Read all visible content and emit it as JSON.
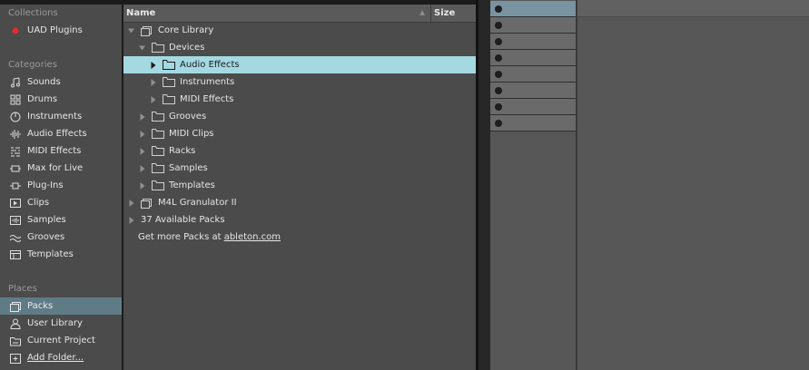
{
  "sidebar": {
    "collections_title": "Collections",
    "collections": [
      {
        "label": "UAD Plugins",
        "icon": "red-dot-icon",
        "color": "#e52b2b"
      }
    ],
    "categories_title": "Categories",
    "categories": [
      {
        "label": "Sounds",
        "icon": "sounds-icon"
      },
      {
        "label": "Drums",
        "icon": "drums-icon"
      },
      {
        "label": "Instruments",
        "icon": "instruments-icon"
      },
      {
        "label": "Audio Effects",
        "icon": "audio-effects-icon"
      },
      {
        "label": "MIDI Effects",
        "icon": "midi-effects-icon"
      },
      {
        "label": "Max for Live",
        "icon": "max-for-live-icon"
      },
      {
        "label": "Plug-Ins",
        "icon": "plugins-icon"
      },
      {
        "label": "Clips",
        "icon": "clips-icon"
      },
      {
        "label": "Samples",
        "icon": "samples-icon"
      },
      {
        "label": "Grooves",
        "icon": "grooves-icon"
      },
      {
        "label": "Templates",
        "icon": "templates-icon"
      }
    ],
    "places_title": "Places",
    "places": [
      {
        "label": "Packs",
        "icon": "packs-icon",
        "active": true
      },
      {
        "label": "User Library",
        "icon": "user-icon"
      },
      {
        "label": "Current Project",
        "icon": "project-icon"
      },
      {
        "label": "Add Folder...",
        "icon": "add-folder-icon"
      }
    ]
  },
  "browser": {
    "name_header": "Name",
    "size_header": "Size",
    "rows": [
      {
        "label": "Core Library",
        "icon": "pack-icon",
        "expanded": true
      },
      {
        "label": "Devices",
        "icon": "folder-icon",
        "expanded": true
      },
      {
        "label": "Audio Effects",
        "icon": "folder-icon",
        "selected": true
      },
      {
        "label": "Instruments",
        "icon": "folder-icon"
      },
      {
        "label": "MIDI Effects",
        "icon": "folder-icon"
      },
      {
        "label": "Grooves",
        "icon": "folder-icon"
      },
      {
        "label": "MIDI Clips",
        "icon": "folder-icon"
      },
      {
        "label": "Racks",
        "icon": "folder-icon"
      },
      {
        "label": "Samples",
        "icon": "folder-icon"
      },
      {
        "label": "Templates",
        "icon": "folder-icon"
      },
      {
        "label": "M4L Granulator II",
        "icon": "pack-icon"
      },
      {
        "label": "37 Available Packs"
      }
    ],
    "get_more_text": "Get more Packs at ",
    "get_more_link": "ableton.com"
  },
  "colors": {
    "selection": "#a5d9e2",
    "active_place": "#5f7b86",
    "clip_slot_selected": "#7993a0"
  }
}
